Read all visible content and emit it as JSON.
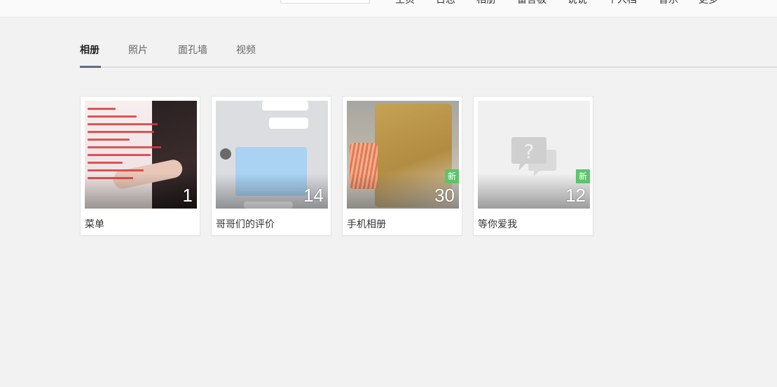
{
  "topbar": {
    "search_placeholder": "",
    "nav": [
      "主页",
      "日志",
      "相册",
      "留言板",
      "说说",
      "个人档",
      "音乐",
      "更多"
    ]
  },
  "tabs": {
    "items": [
      "相册",
      "照片",
      "面孔墙",
      "视频"
    ],
    "active_index": 0
  },
  "albums": [
    {
      "name": "菜单",
      "count": "1",
      "badge": "",
      "cover": "poster-image"
    },
    {
      "name": "哥哥们的评价",
      "count": "14",
      "badge": "",
      "cover": "chat-screenshot-image"
    },
    {
      "name": "手机相册",
      "count": "30",
      "badge": "新",
      "cover": "food-bag-image"
    },
    {
      "name": "等你爱我",
      "count": "12",
      "badge": "新",
      "cover": "empty-album-icon"
    }
  ],
  "colors": {
    "background": "#f2f2f2",
    "tab_underline": "#5a6f86",
    "new_badge": "#5cc46a"
  }
}
